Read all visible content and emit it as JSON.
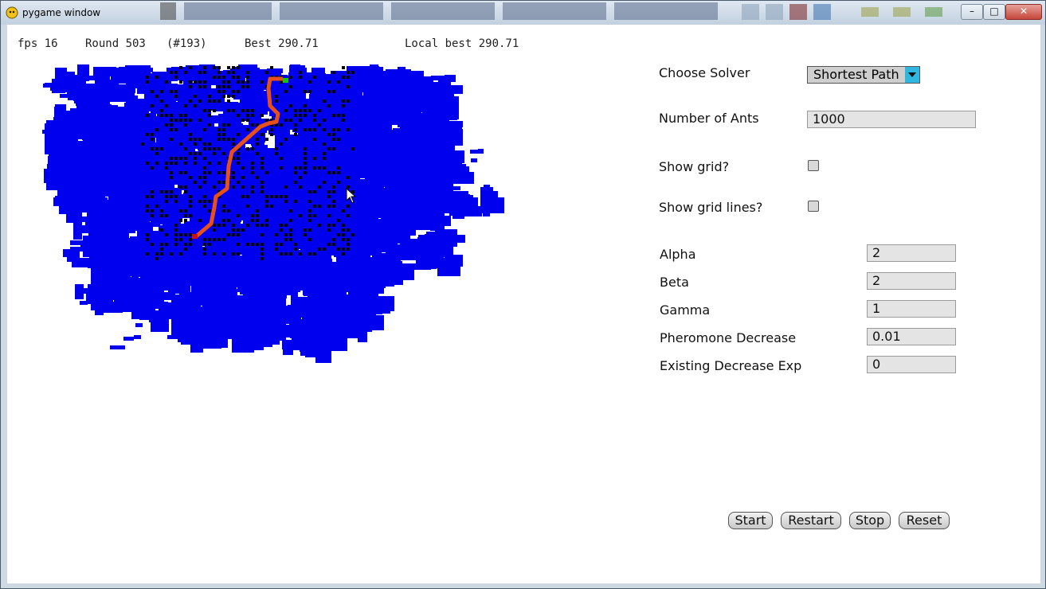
{
  "window": {
    "title": "pygame window",
    "controls": [
      "–",
      "□",
      "✕"
    ]
  },
  "hud": {
    "fps": "fps 16",
    "round": "Round 503",
    "round_id": "(#193)",
    "best": "Best 290.71",
    "local_best": "Local best 290.71"
  },
  "controls": {
    "solver_label": "Choose Solver",
    "solver_value": "Shortest Path",
    "ants_label": "Number of Ants",
    "ants_value": "1000",
    "show_grid_label": "Show grid?",
    "show_grid_lines_label": "Show grid lines?",
    "params": [
      {
        "label": "Alpha",
        "value": "2"
      },
      {
        "label": "Beta",
        "value": "2"
      },
      {
        "label": "Gamma",
        "value": "1"
      },
      {
        "label": "Pheromone Decrease",
        "value": "0.01"
      },
      {
        "label": "Existing Decrease Exp",
        "value": "0"
      }
    ],
    "buttons": [
      "Start",
      "Restart",
      "Stop",
      "Reset"
    ]
  },
  "colors": {
    "explored": "#0000ee",
    "path": "#e8501a",
    "goal": "#16c416",
    "obstacle": "#000000"
  }
}
